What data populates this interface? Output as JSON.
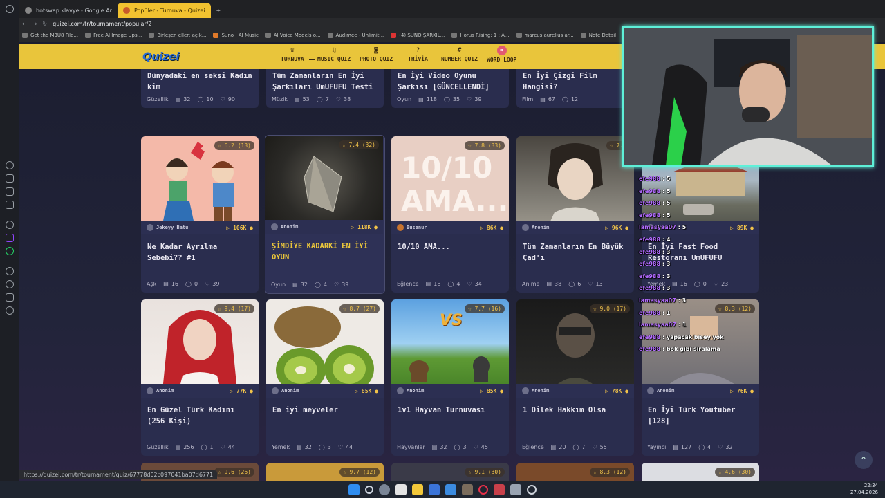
{
  "browser": {
    "tabs": [
      {
        "label": "hotswap klavye - Google Ar",
        "active": false
      },
      {
        "label": "Popüler - Turnuva - Quizei",
        "active": true
      }
    ],
    "url": "quizei.com/tr/tournament/popular/2",
    "bookmarks": [
      "Get the M3U8 File...",
      "Free AI Image Ups...",
      "Birleşen eller: açık...",
      "Suno | AI Music",
      "AI Voice Models o...",
      "Audimee - Unlimit...",
      "(4) SUNO ŞARKIL...",
      "Horus Rising: 1 : A...",
      "marcus aurelius ar...",
      "Note Detail"
    ],
    "status_url": "https://quizei.com/tr/tournament/quiz/67778d02c097041ba07d6771"
  },
  "site": {
    "logo": "Quizei",
    "nav": [
      {
        "label": "TURNUVA",
        "icon": "trophy-icon"
      },
      {
        "label": "MUSIC QUIZ",
        "icon": "music-icon"
      },
      {
        "label": "PHOTO QUIZ",
        "icon": "camera-icon"
      },
      {
        "label": "TRİVİA",
        "icon": "question-icon"
      },
      {
        "label": "NUMBER QUIZ",
        "icon": "hash-icon"
      },
      {
        "label": "WORD LOOP",
        "icon": "loop-icon"
      }
    ]
  },
  "cards": [
    {
      "title": "Dünyadaki en seksi Kadın kim",
      "category": "Güzellik",
      "questions": "32",
      "comments": "10",
      "likes": "90"
    },
    {
      "title": "Tüm Zamanların En İyi Şarkıları UmUFUFU Testi",
      "category": "Müzik",
      "questions": "53",
      "comments": "7",
      "likes": "38"
    },
    {
      "title": "En İyi Video Oyunu Şarkısı [GÜNCELLENDİ]",
      "category": "Oyun",
      "questions": "118",
      "comments": "35",
      "likes": "39"
    },
    {
      "title": "En İyi Çizgi Film Hangisi?",
      "category": "Film",
      "questions": "67",
      "comments": "12",
      "likes": ""
    },
    {
      "title": "Ne Kadar Ayrılma Sebebi?? #1",
      "category": "Aşk",
      "questions": "16",
      "comments": "0",
      "likes": "39",
      "rating": "6.2 (13)",
      "author": "Jekeyy Batu",
      "views": "106K"
    },
    {
      "title": "ŞİMDİYE KADARKİ EN İYİ OYUN",
      "category": "Oyun",
      "questions": "32",
      "comments": "4",
      "likes": "39",
      "rating": "7.4 (32)",
      "author": "Anonim",
      "views": "118K"
    },
    {
      "title": "10/10 AMA...",
      "category": "Eğlence",
      "questions": "18",
      "comments": "4",
      "likes": "34",
      "rating": "7.8 (33)",
      "author": "Busenur",
      "views": "86K",
      "thumb_text": "10/10 AMA..."
    },
    {
      "title": "Tüm Zamanların En Büyük Çad'ı",
      "category": "Anime",
      "questions": "38",
      "comments": "6",
      "likes": "13",
      "rating": "7.9",
      "author": "Anonim",
      "views": "96K"
    },
    {
      "title": "En İyi Fast Food Restoranı UmUFUFU",
      "category": "Yemek",
      "questions": "16",
      "comments": "0",
      "likes": "23",
      "rating": "",
      "author": "Anonim",
      "views": "89K"
    },
    {
      "title": "En Güzel Türk Kadını (256 Kişi)",
      "category": "Güzellik",
      "questions": "256",
      "comments": "1",
      "likes": "44",
      "rating": "9.4 (17)",
      "author": "Anonim",
      "views": "77K"
    },
    {
      "title": "En iyi meyveler",
      "category": "Yemek",
      "questions": "32",
      "comments": "3",
      "likes": "44",
      "rating": "8.7 (27)",
      "author": "Anonim",
      "views": "85K"
    },
    {
      "title": "1v1 Hayvan Turnuvası",
      "category": "Hayvanlar",
      "questions": "32",
      "comments": "3",
      "likes": "45",
      "rating": "7.7 (16)",
      "author": "Anonim",
      "views": "85K",
      "thumb_text": "VS"
    },
    {
      "title": "1 Dilek Hakkım Olsa",
      "category": "Eğlence",
      "questions": "20",
      "comments": "7",
      "likes": "55",
      "rating": "9.0 (17)",
      "author": "Anonim",
      "views": "78K"
    },
    {
      "title": "En İyi Türk Youtuber [128]",
      "category": "Yayıncı",
      "questions": "127",
      "comments": "4",
      "likes": "32",
      "rating": "8.3 (12)",
      "author": "Anonim",
      "views": "76K"
    },
    {
      "rating": "9.6 (26)"
    },
    {
      "rating": "9.7 (12)"
    },
    {
      "rating": "9.1 (30)"
    },
    {
      "rating": "8.3 (12)"
    },
    {
      "rating": "4.6 (30)"
    }
  ],
  "chat": [
    {
      "user": "efe988",
      "msg": "5"
    },
    {
      "user": "efe988",
      "msg": "5"
    },
    {
      "user": "efe988",
      "msg": "5"
    },
    {
      "user": "efe988",
      "msg": "5"
    },
    {
      "user": "lamasyaa07",
      "msg": "5"
    },
    {
      "user": "efe988",
      "msg": "4"
    },
    {
      "user": "efe988",
      "msg": "3"
    },
    {
      "user": "efe988",
      "msg": "3"
    },
    {
      "user": "efe988",
      "msg": "3"
    },
    {
      "user": "efe988",
      "msg": "3"
    },
    {
      "user": "lamasyaa07",
      "msg": "3"
    },
    {
      "user": "efe988",
      "msg": "1"
    },
    {
      "user": "lamasyaa07",
      "msg": "1"
    },
    {
      "user": "efe988",
      "msg": "yapacak bisey yok"
    },
    {
      "user": "efe988",
      "msg": "bok gibi siralama"
    }
  ],
  "tray": {
    "time": "22:34",
    "date": "27.04.2026"
  }
}
